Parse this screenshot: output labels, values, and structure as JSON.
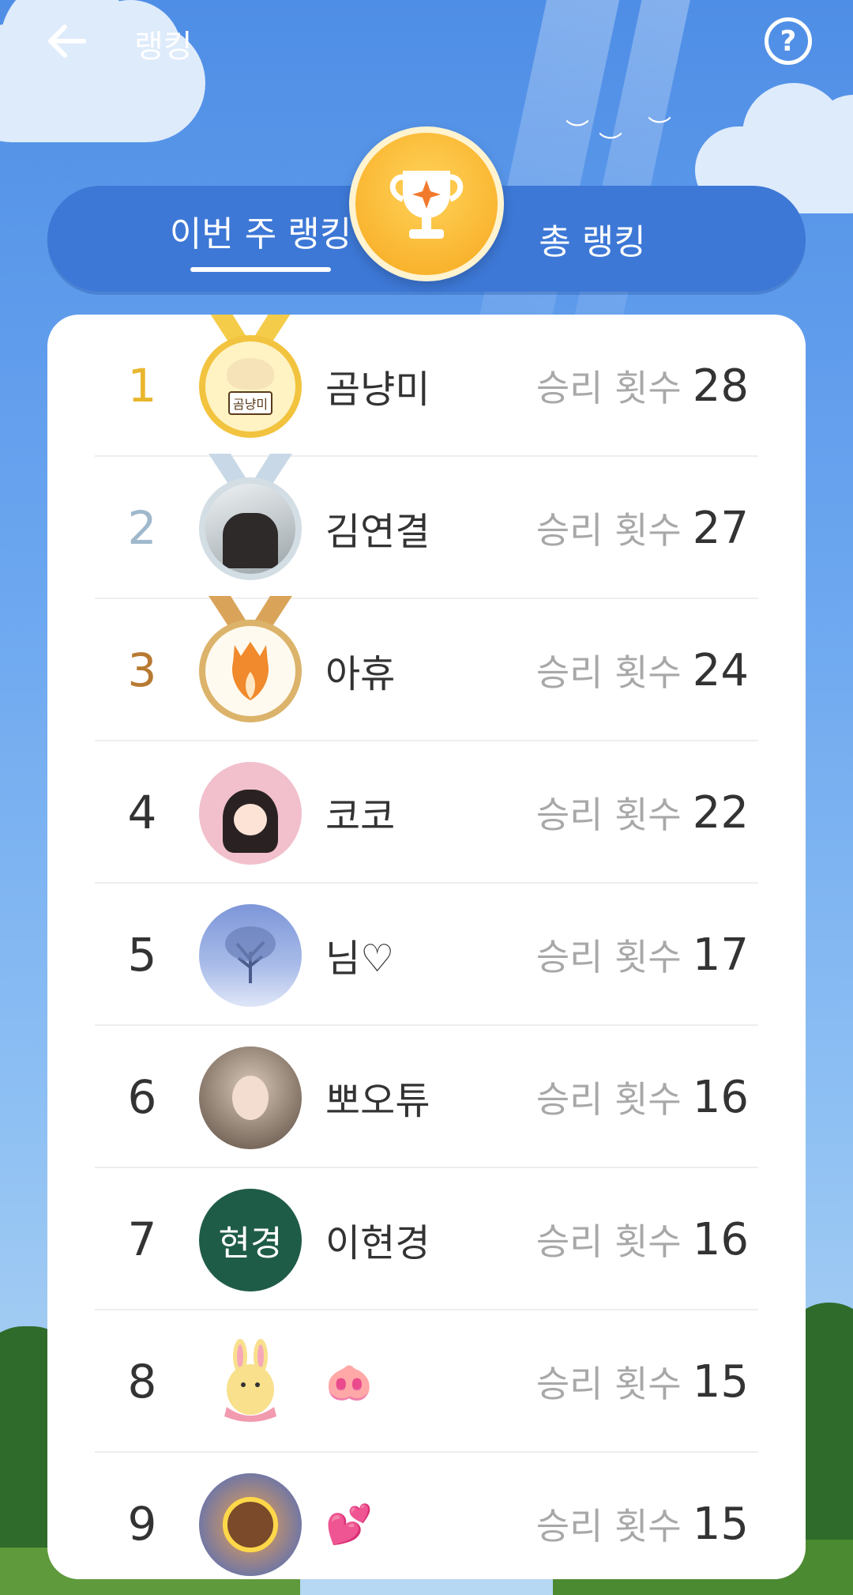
{
  "header": {
    "title": "랭킹"
  },
  "tabs": {
    "weekly": "이번 주 랭킹",
    "total": "총 랭킹",
    "active": "weekly"
  },
  "ranking": {
    "wins_label": "승리 횟수",
    "rows": [
      {
        "rank": "1",
        "nickname": "곰냥미",
        "wins": "28",
        "medal": "gold",
        "avatar": "cat-badge-avatar",
        "avatar_text": "곰냥미"
      },
      {
        "rank": "2",
        "nickname": "김연결",
        "wins": "27",
        "medal": "silver",
        "avatar": "photo-avatar"
      },
      {
        "rank": "3",
        "nickname": "아휴",
        "wins": "24",
        "medal": "bronze",
        "avatar": "fox-avatar"
      },
      {
        "rank": "4",
        "nickname": "코코",
        "wins": "22",
        "medal": "",
        "avatar": "girl-avatar"
      },
      {
        "rank": "5",
        "nickname": "님♡",
        "wins": "17",
        "medal": "",
        "avatar": "winter-tree-avatar"
      },
      {
        "rank": "6",
        "nickname": "뽀오튜",
        "wins": "16",
        "medal": "",
        "avatar": "flower-portrait-avatar"
      },
      {
        "rank": "7",
        "nickname": "이현경",
        "wins": "16",
        "medal": "",
        "avatar": "initials-avatar",
        "avatar_text": "현경"
      },
      {
        "rank": "8",
        "nickname": "🐽",
        "wins": "15",
        "medal": "",
        "avatar": "bunny-avatar"
      },
      {
        "rank": "9",
        "nickname": "💕",
        "wins": "15",
        "medal": "",
        "avatar": "comic-avatar"
      }
    ]
  },
  "colors": {
    "gold": "#e8b62e",
    "silver": "#9fb8cc",
    "bronze": "#b87a32",
    "tab_bg": "#3d78d6",
    "initials_avatar": "#1f5c48"
  }
}
